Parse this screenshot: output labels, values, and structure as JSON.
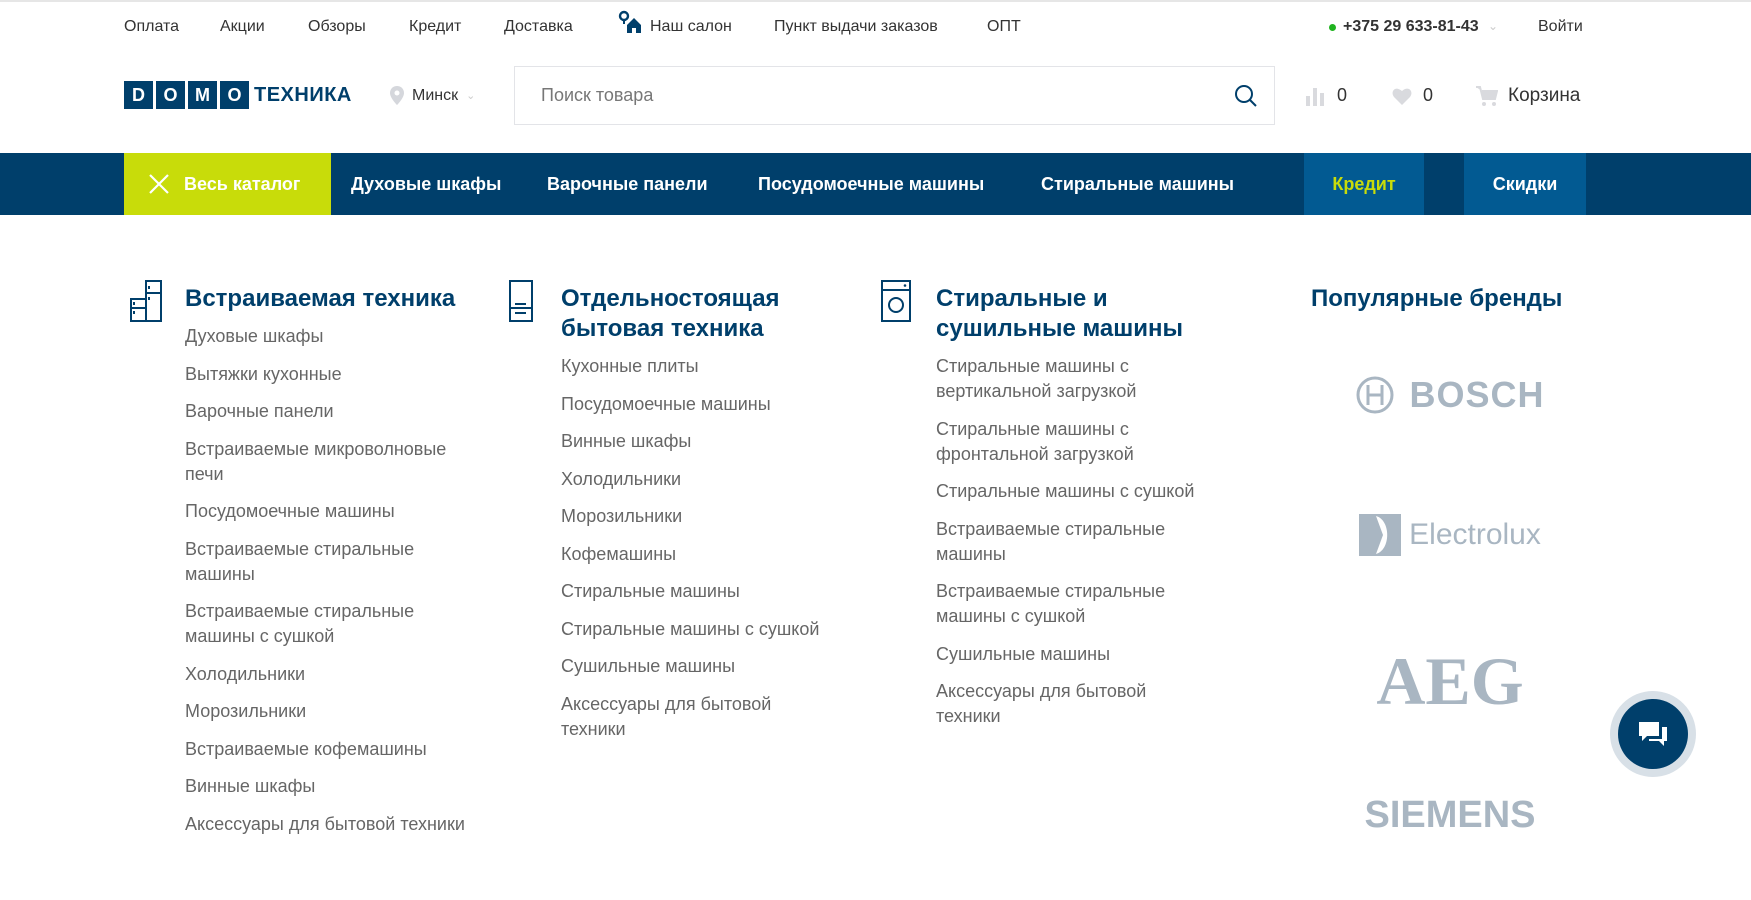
{
  "topbar": {
    "links": [
      "Оплата",
      "Акции",
      "Обзоры",
      "Кредит",
      "Доставка",
      "Наш салон",
      "Пункт выдачи заказов",
      "ОПТ"
    ],
    "phone": "+375 29 633-81-43",
    "login": "Войти",
    "status_color": "#1fb31f"
  },
  "header": {
    "logo_letters": [
      "D",
      "O",
      "M",
      "O"
    ],
    "logo_text": "ТЕХНИКА",
    "city": "Минск",
    "search_placeholder": "Поиск товара",
    "compare_count": "0",
    "favorites_count": "0",
    "cart_label": "Корзина"
  },
  "nav": {
    "catalog": "Весь каталог",
    "items": [
      "Духовые шкафы",
      "Варочные панели",
      "Посудомоечные машины",
      "Стиральные машины"
    ],
    "credit": "Кредит",
    "discounts": "Скидки",
    "accent": "#c8dc0a",
    "brand": "#003f6b"
  },
  "catalog": [
    {
      "title": "Встраиваемая техника",
      "items": [
        "Духовые шкафы",
        "Вытяжки кухонные",
        "Варочные панели",
        "Встраиваемые микроволновые печи",
        "Посудомоечные машины",
        "Встраиваемые стиральные машины",
        "Встраиваемые стиральные машины с сушкой",
        "Холодильники",
        "Морозильники",
        "Встраиваемые кофемашины",
        "Винные шкафы",
        "Аксессуары для бытовой техники"
      ]
    },
    {
      "title": "Отдельностоящая бытовая техника",
      "items": [
        "Кухонные плиты",
        "Посудомоечные машины",
        "Винные шкафы",
        "Холодильники",
        "Морозильники",
        "Кофемашины",
        "Стиральные машины",
        "Стиральные машины с сушкой",
        "Сушильные машины",
        "Аксессуары для бытовой техники"
      ]
    },
    {
      "title": "Стиральные и сушильные машины",
      "items": [
        "Стиральные машины с вертикальной загрузкой",
        "Стиральные машины с фронтальной загрузкой",
        "Стиральные машины с сушкой",
        "Встраиваемые стиральные машины",
        "Встраиваемые стиральные машины с сушкой",
        "Сушильные машины",
        "Аксессуары для бытовой техники"
      ]
    }
  ],
  "brands": {
    "title": "Популярные бренды",
    "items": [
      "BOSCH",
      "Electrolux",
      "AEG",
      "SIEMENS"
    ]
  }
}
